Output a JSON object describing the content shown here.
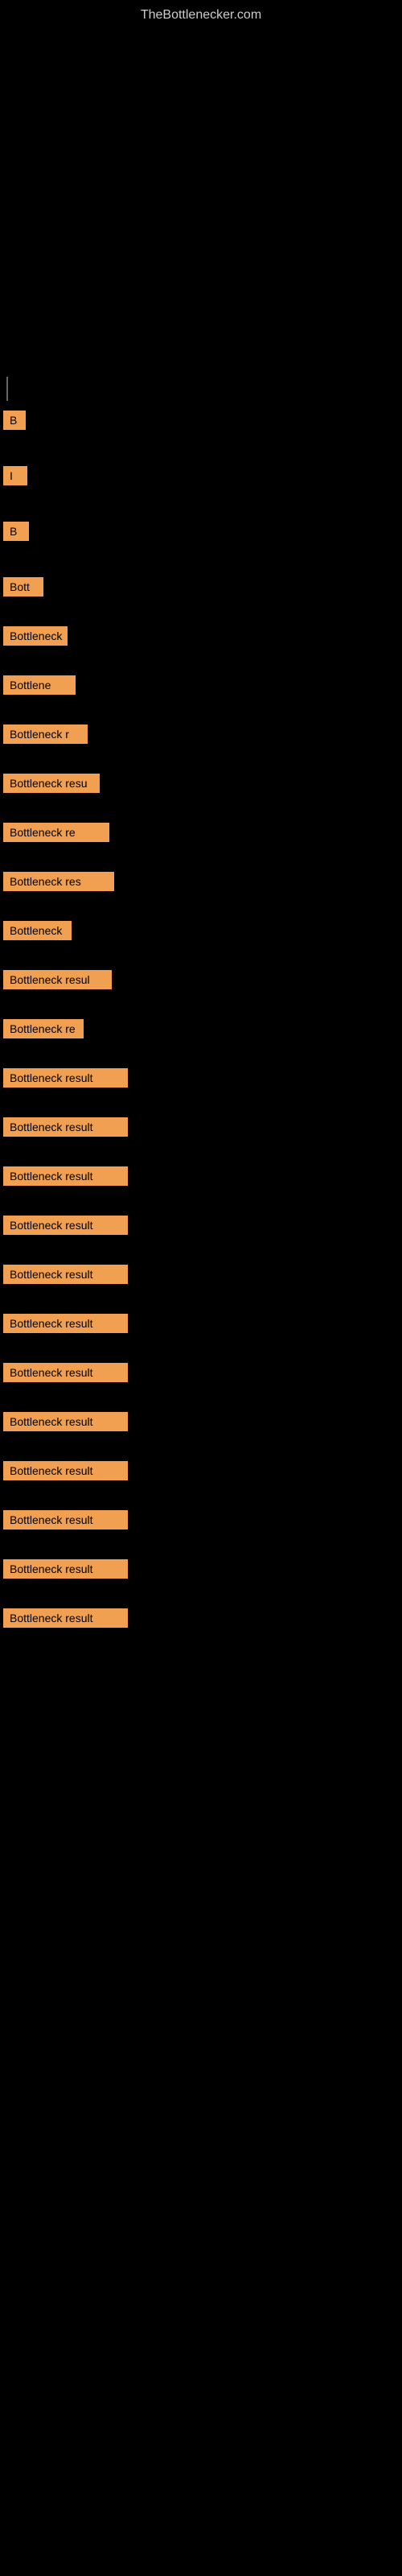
{
  "site": {
    "title": "TheBottlenecker.com"
  },
  "items": [
    {
      "id": 1,
      "label": "B",
      "size_class": "size-1",
      "spacing": "spacer-large"
    },
    {
      "id": 2,
      "label": "I",
      "size_class": "size-2",
      "spacing": "spacer-small"
    },
    {
      "id": 3,
      "label": "B",
      "size_class": "size-3",
      "spacing": "spacer-small"
    },
    {
      "id": 4,
      "label": "Bott",
      "size_class": "size-4",
      "spacing": "spacer-small"
    },
    {
      "id": 5,
      "label": "Bottleneck",
      "size_class": "size-5",
      "spacing": "spacer-small"
    },
    {
      "id": 6,
      "label": "Bottlene",
      "size_class": "size-6",
      "spacing": "spacer-small"
    },
    {
      "id": 7,
      "label": "Bottleneck r",
      "size_class": "size-7",
      "spacing": "spacer-small"
    },
    {
      "id": 8,
      "label": "Bottleneck resu",
      "size_class": "size-8",
      "spacing": "spacer-small"
    },
    {
      "id": 9,
      "label": "Bottleneck re",
      "size_class": "size-9",
      "spacing": "spacer-small"
    },
    {
      "id": 10,
      "label": "Bottleneck res",
      "size_class": "size-10",
      "spacing": "spacer-small"
    },
    {
      "id": 11,
      "label": "Bottleneck",
      "size_class": "size-11",
      "spacing": "spacer-small"
    },
    {
      "id": 12,
      "label": "Bottleneck resul",
      "size_class": "size-12",
      "spacing": "spacer-small"
    },
    {
      "id": 13,
      "label": "Bottleneck re",
      "size_class": "size-13",
      "spacing": "spacer-small"
    },
    {
      "id": 14,
      "label": "Bottleneck result",
      "size_class": "size-14",
      "spacing": "spacer-small"
    },
    {
      "id": 15,
      "label": "Bottleneck result",
      "size_class": "size-15",
      "spacing": "spacer-small"
    },
    {
      "id": 16,
      "label": "Bottleneck result",
      "size_class": "size-16",
      "spacing": "spacer-small"
    },
    {
      "id": 17,
      "label": "Bottleneck result",
      "size_class": "size-17",
      "spacing": "spacer-small"
    },
    {
      "id": 18,
      "label": "Bottleneck result",
      "size_class": "size-18",
      "spacing": "spacer-small"
    },
    {
      "id": 19,
      "label": "Bottleneck result",
      "size_class": "size-19",
      "spacing": "spacer-small"
    },
    {
      "id": 20,
      "label": "Bottleneck result",
      "size_class": "size-20",
      "spacing": "spacer-small"
    },
    {
      "id": 21,
      "label": "Bottleneck result",
      "size_class": "size-21",
      "spacing": "spacer-small"
    },
    {
      "id": 22,
      "label": "Bottleneck result",
      "size_class": "size-22",
      "spacing": "spacer-small"
    },
    {
      "id": 23,
      "label": "Bottleneck result",
      "size_class": "size-23",
      "spacing": "spacer-small"
    },
    {
      "id": 24,
      "label": "Bottleneck result",
      "size_class": "size-24",
      "spacing": "spacer-small"
    },
    {
      "id": 25,
      "label": "Bottleneck result",
      "size_class": "size-25",
      "spacing": "spacer-small"
    }
  ]
}
